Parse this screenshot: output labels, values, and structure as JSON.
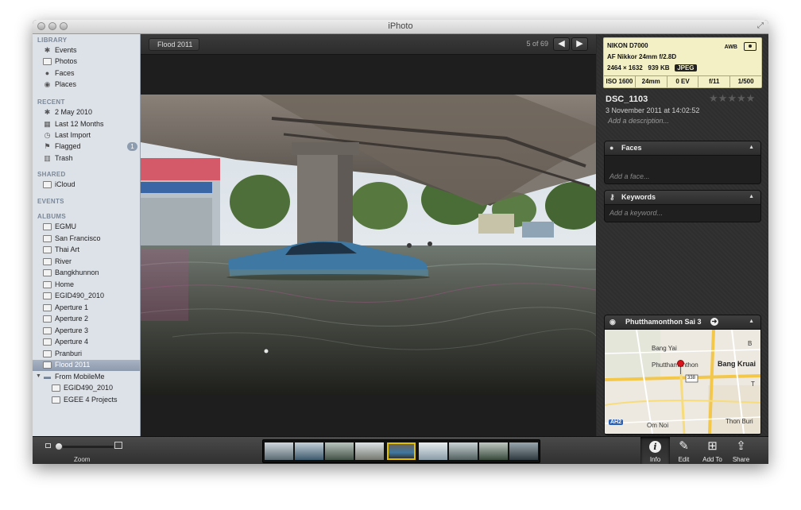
{
  "window": {
    "title": "iPhoto"
  },
  "sidebar": {
    "sections": {
      "library": "LIBRARY",
      "recent": "RECENT",
      "shared": "SHARED",
      "events": "EVENTS",
      "albums": "ALBUMS"
    },
    "library": [
      {
        "label": "Events",
        "icon": "palm-tree-icon"
      },
      {
        "label": "Photos",
        "icon": "photos-icon"
      },
      {
        "label": "Faces",
        "icon": "person-icon"
      },
      {
        "label": "Places",
        "icon": "globe-icon"
      }
    ],
    "recent": [
      {
        "label": "2 May 2010",
        "icon": "palm-tree-icon"
      },
      {
        "label": "Last 12 Months",
        "icon": "calendar-icon"
      },
      {
        "label": "Last Import",
        "icon": "clock-icon"
      },
      {
        "label": "Flagged",
        "icon": "flag-icon",
        "badge": "1"
      },
      {
        "label": "Trash",
        "icon": "trash-icon"
      }
    ],
    "shared": [
      {
        "label": "iCloud",
        "icon": "cloud-icon"
      }
    ],
    "albums": [
      {
        "label": "EGMU"
      },
      {
        "label": "San Francisco"
      },
      {
        "label": "Thai Art"
      },
      {
        "label": "River"
      },
      {
        "label": "Bangkhunnon"
      },
      {
        "label": "Home"
      },
      {
        "label": "EGID490_2010"
      },
      {
        "label": "Aperture 1"
      },
      {
        "label": "Aperture 2"
      },
      {
        "label": "Aperture 3"
      },
      {
        "label": "Aperture 4"
      },
      {
        "label": "Pranburi"
      },
      {
        "label": "Flood 2011",
        "selected": true
      }
    ],
    "folder": {
      "label": "From MobileMe",
      "children": [
        {
          "label": "EGID490_2010"
        },
        {
          "label": "EGEE 4 Projects"
        }
      ]
    }
  },
  "viewer": {
    "breadcrumb": "Flood 2011",
    "counter": "5 of 69",
    "prev_glyph": "◀",
    "next_glyph": "▶"
  },
  "info": {
    "camera": "NIKON D7000",
    "lens": "AF Nikkor 24mm f/2.8D",
    "dimensions": "2464 × 1632",
    "size": "939 KB",
    "format": "JPEG",
    "awb": "AWB",
    "iso": "ISO 1600",
    "focal": "24mm",
    "ev": "0 EV",
    "aperture": "f/11",
    "shutter": "1/500",
    "title": "DSC_1103",
    "date": "3 November 2011 at 14:02:52",
    "description_placeholder": "Add a description...",
    "rating": 0,
    "faces": {
      "title": "Faces",
      "placeholder": "Add a face..."
    },
    "keywords": {
      "title": "Keywords",
      "placeholder": "Add a keyword..."
    },
    "place": {
      "title": "Phutthamonthon Sai 3",
      "labels": {
        "bang_yai": "Bang Yai",
        "phutthamonthon": "Phutthamonthon",
        "bang_kruai": "Bang Kruai",
        "om_noi": "Om Noi",
        "thon_buri": "Thon Buri",
        "ah2": "AH2",
        "route": "338",
        "b": "B",
        "t": "T"
      }
    }
  },
  "toolbar": {
    "zoom_label": "Zoom",
    "zoom_value": 0.0,
    "info_label": "Info",
    "edit_label": "Edit",
    "add_label": "Add To",
    "share_label": "Share"
  },
  "colors": {
    "sidebar_bg": "#dde2e9",
    "exif_bg": "#f3f0c6",
    "selection_yellow": "#e0c000",
    "map_pin": "#d8121b"
  }
}
